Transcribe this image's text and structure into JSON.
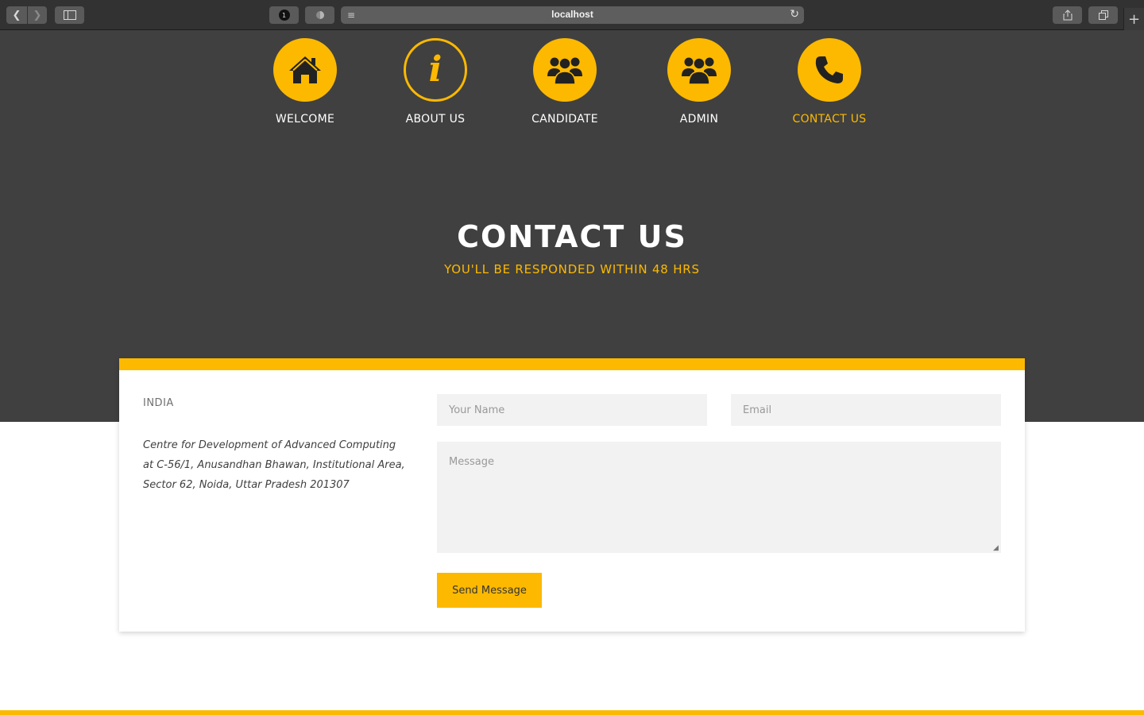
{
  "browser": {
    "url": "localhost",
    "ext1_badge": "1"
  },
  "nav": {
    "items": [
      {
        "label": "WELCOME",
        "icon": "home-icon"
      },
      {
        "label": "ABOUT US",
        "icon": "info-icon"
      },
      {
        "label": "CANDIDATE",
        "icon": "users-icon"
      },
      {
        "label": "ADMIN",
        "icon": "users-icon"
      },
      {
        "label": "CONTACT US",
        "icon": "phone-icon",
        "active": true
      }
    ]
  },
  "hero": {
    "title": "CONTACT US",
    "subtitle": "YOU'LL BE RESPONDED WITHIN 48 HRS"
  },
  "contact": {
    "country": "INDIA",
    "address_line1": "Centre for Development of Advanced Computing",
    "address_line2": "at C-56/1, Anusandhan Bhawan, Institutional Area, Sector 62, Noida, Uttar Pradesh 201307"
  },
  "form": {
    "name_placeholder": "Your Name",
    "email_placeholder": "Email",
    "message_placeholder": "Message",
    "send_label": "Send Message"
  },
  "colors": {
    "accent": "#fcb900",
    "hero_bg": "#404040"
  }
}
